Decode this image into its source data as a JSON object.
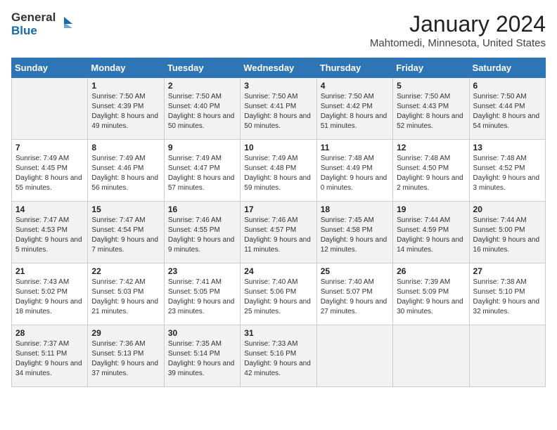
{
  "header": {
    "logo_line1": "General",
    "logo_line2": "Blue",
    "month": "January 2024",
    "location": "Mahtomedi, Minnesota, United States"
  },
  "days_of_week": [
    "Sunday",
    "Monday",
    "Tuesday",
    "Wednesday",
    "Thursday",
    "Friday",
    "Saturday"
  ],
  "weeks": [
    [
      {
        "num": "",
        "sunrise": "",
        "sunset": "",
        "daylight": ""
      },
      {
        "num": "1",
        "sunrise": "Sunrise: 7:50 AM",
        "sunset": "Sunset: 4:39 PM",
        "daylight": "Daylight: 8 hours and 49 minutes."
      },
      {
        "num": "2",
        "sunrise": "Sunrise: 7:50 AM",
        "sunset": "Sunset: 4:40 PM",
        "daylight": "Daylight: 8 hours and 50 minutes."
      },
      {
        "num": "3",
        "sunrise": "Sunrise: 7:50 AM",
        "sunset": "Sunset: 4:41 PM",
        "daylight": "Daylight: 8 hours and 50 minutes."
      },
      {
        "num": "4",
        "sunrise": "Sunrise: 7:50 AM",
        "sunset": "Sunset: 4:42 PM",
        "daylight": "Daylight: 8 hours and 51 minutes."
      },
      {
        "num": "5",
        "sunrise": "Sunrise: 7:50 AM",
        "sunset": "Sunset: 4:43 PM",
        "daylight": "Daylight: 8 hours and 52 minutes."
      },
      {
        "num": "6",
        "sunrise": "Sunrise: 7:50 AM",
        "sunset": "Sunset: 4:44 PM",
        "daylight": "Daylight: 8 hours and 54 minutes."
      }
    ],
    [
      {
        "num": "7",
        "sunrise": "Sunrise: 7:49 AM",
        "sunset": "Sunset: 4:45 PM",
        "daylight": "Daylight: 8 hours and 55 minutes."
      },
      {
        "num": "8",
        "sunrise": "Sunrise: 7:49 AM",
        "sunset": "Sunset: 4:46 PM",
        "daylight": "Daylight: 8 hours and 56 minutes."
      },
      {
        "num": "9",
        "sunrise": "Sunrise: 7:49 AM",
        "sunset": "Sunset: 4:47 PM",
        "daylight": "Daylight: 8 hours and 57 minutes."
      },
      {
        "num": "10",
        "sunrise": "Sunrise: 7:49 AM",
        "sunset": "Sunset: 4:48 PM",
        "daylight": "Daylight: 8 hours and 59 minutes."
      },
      {
        "num": "11",
        "sunrise": "Sunrise: 7:48 AM",
        "sunset": "Sunset: 4:49 PM",
        "daylight": "Daylight: 9 hours and 0 minutes."
      },
      {
        "num": "12",
        "sunrise": "Sunrise: 7:48 AM",
        "sunset": "Sunset: 4:50 PM",
        "daylight": "Daylight: 9 hours and 2 minutes."
      },
      {
        "num": "13",
        "sunrise": "Sunrise: 7:48 AM",
        "sunset": "Sunset: 4:52 PM",
        "daylight": "Daylight: 9 hours and 3 minutes."
      }
    ],
    [
      {
        "num": "14",
        "sunrise": "Sunrise: 7:47 AM",
        "sunset": "Sunset: 4:53 PM",
        "daylight": "Daylight: 9 hours and 5 minutes."
      },
      {
        "num": "15",
        "sunrise": "Sunrise: 7:47 AM",
        "sunset": "Sunset: 4:54 PM",
        "daylight": "Daylight: 9 hours and 7 minutes."
      },
      {
        "num": "16",
        "sunrise": "Sunrise: 7:46 AM",
        "sunset": "Sunset: 4:55 PM",
        "daylight": "Daylight: 9 hours and 9 minutes."
      },
      {
        "num": "17",
        "sunrise": "Sunrise: 7:46 AM",
        "sunset": "Sunset: 4:57 PM",
        "daylight": "Daylight: 9 hours and 11 minutes."
      },
      {
        "num": "18",
        "sunrise": "Sunrise: 7:45 AM",
        "sunset": "Sunset: 4:58 PM",
        "daylight": "Daylight: 9 hours and 12 minutes."
      },
      {
        "num": "19",
        "sunrise": "Sunrise: 7:44 AM",
        "sunset": "Sunset: 4:59 PM",
        "daylight": "Daylight: 9 hours and 14 minutes."
      },
      {
        "num": "20",
        "sunrise": "Sunrise: 7:44 AM",
        "sunset": "Sunset: 5:00 PM",
        "daylight": "Daylight: 9 hours and 16 minutes."
      }
    ],
    [
      {
        "num": "21",
        "sunrise": "Sunrise: 7:43 AM",
        "sunset": "Sunset: 5:02 PM",
        "daylight": "Daylight: 9 hours and 18 minutes."
      },
      {
        "num": "22",
        "sunrise": "Sunrise: 7:42 AM",
        "sunset": "Sunset: 5:03 PM",
        "daylight": "Daylight: 9 hours and 21 minutes."
      },
      {
        "num": "23",
        "sunrise": "Sunrise: 7:41 AM",
        "sunset": "Sunset: 5:05 PM",
        "daylight": "Daylight: 9 hours and 23 minutes."
      },
      {
        "num": "24",
        "sunrise": "Sunrise: 7:40 AM",
        "sunset": "Sunset: 5:06 PM",
        "daylight": "Daylight: 9 hours and 25 minutes."
      },
      {
        "num": "25",
        "sunrise": "Sunrise: 7:40 AM",
        "sunset": "Sunset: 5:07 PM",
        "daylight": "Daylight: 9 hours and 27 minutes."
      },
      {
        "num": "26",
        "sunrise": "Sunrise: 7:39 AM",
        "sunset": "Sunset: 5:09 PM",
        "daylight": "Daylight: 9 hours and 30 minutes."
      },
      {
        "num": "27",
        "sunrise": "Sunrise: 7:38 AM",
        "sunset": "Sunset: 5:10 PM",
        "daylight": "Daylight: 9 hours and 32 minutes."
      }
    ],
    [
      {
        "num": "28",
        "sunrise": "Sunrise: 7:37 AM",
        "sunset": "Sunset: 5:11 PM",
        "daylight": "Daylight: 9 hours and 34 minutes."
      },
      {
        "num": "29",
        "sunrise": "Sunrise: 7:36 AM",
        "sunset": "Sunset: 5:13 PM",
        "daylight": "Daylight: 9 hours and 37 minutes."
      },
      {
        "num": "30",
        "sunrise": "Sunrise: 7:35 AM",
        "sunset": "Sunset: 5:14 PM",
        "daylight": "Daylight: 9 hours and 39 minutes."
      },
      {
        "num": "31",
        "sunrise": "Sunrise: 7:33 AM",
        "sunset": "Sunset: 5:16 PM",
        "daylight": "Daylight: 9 hours and 42 minutes."
      },
      {
        "num": "",
        "sunrise": "",
        "sunset": "",
        "daylight": ""
      },
      {
        "num": "",
        "sunrise": "",
        "sunset": "",
        "daylight": ""
      },
      {
        "num": "",
        "sunrise": "",
        "sunset": "",
        "daylight": ""
      }
    ]
  ]
}
